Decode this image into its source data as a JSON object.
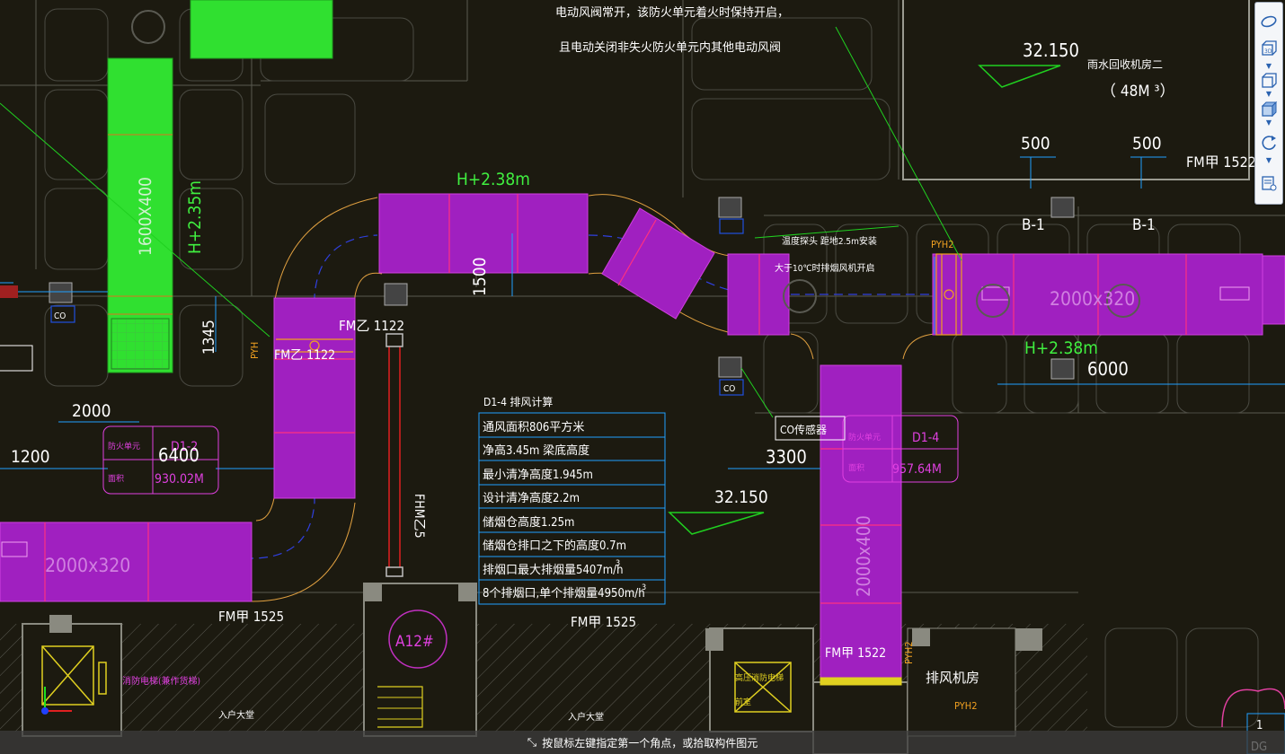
{
  "notes": {
    "line1": "电动风阀常开，该防火单元着火时保持开启，",
    "line2": "且电动关闭非失火防火单元内其他电动风阀"
  },
  "drawing_labels": {
    "elev_top": "32.150",
    "room_name": "雨水回收机房二",
    "room_area": "（ 48M ³）",
    "dim_500_a": "500",
    "dim_500_b": "500",
    "fm_1522_top": "FM甲 1522",
    "b1_a": "B-1",
    "b1_b": "B-1",
    "h238_top": "H+2.38m",
    "h235": "H+2.35m",
    "duct_160x400": "1600X400",
    "dim_1500": "1500",
    "dim_1345": "1345",
    "fm_1122_a": "FM乙 1122",
    "fm_1122_b": "FM乙 1122",
    "pyh_left": "PYH",
    "pyh2_top": "PYH2",
    "co_left": "CO",
    "co_mid": "CO",
    "dim_2000": "2000",
    "dim_1200": "1200",
    "d12_name": "D1-2",
    "d12_a": "防火单元",
    "d12_b": "面积",
    "d12_area": "930.02M",
    "duct_6400": "6400",
    "duct_2000x320_left": "2000x320",
    "duct_2000x320_right": "2000x320",
    "h238_right": "H+2.38m",
    "dim_6000": "6000",
    "dim_3300": "3300",
    "elev_mid": "32.150",
    "co_sensor": "CO传感器",
    "d14_name": "D1-4",
    "d14_a": "防火单元",
    "d14_b": "面积",
    "d14_area": "957.64M",
    "duct_2000x400": "2000x400",
    "fm_1525_left": "FM甲 1525",
    "fm_1525_mid": "FM甲 1525",
    "fm_1522_bottom": "FM甲 1522",
    "a12": "A12#",
    "fhm": "FHM乙5",
    "pyh_bottom": "PYH2",
    "pyh2_bottom_right": "PYH2",
    "exhaust_room": "排风机房",
    "entrance_a": "入户大堂",
    "entrance_b": "入户大堂",
    "yellow_note_a": "高压消防电梯",
    "yellow_note_b": "前室",
    "magenta_note": "消防电梯(兼作货梯)",
    "exhaust_note_a": "温度探头 距地2.5m安装",
    "exhaust_note_b": "大于10℃时排烟风机开启",
    "bottom_right_a": "1",
    "bottom_right_b": "DG"
  },
  "table": {
    "title": "D1-4 排风计算",
    "rows": [
      "通风面积806平方米",
      "净高3.45m 梁底高度",
      "最小清净高度1.945m",
      "设计清净高度2.2m",
      "储烟仓高度1.25m",
      "储烟仓排口之下的高度0.7m",
      "排烟口最大排烟量5407m/h",
      "8个排烟口,单个排烟量4950m/h"
    ],
    "sup_a": "3",
    "sup_b": "3"
  },
  "toolbar": {
    "items": [
      "orbit-icon",
      "view-3d-icon",
      "cube-outline-icon",
      "cube-solid-icon",
      "rotate-icon",
      "properties-icon"
    ],
    "label_3d": "3D"
  },
  "status": {
    "icon": "cursor-cross-icon",
    "text": "按鼠标左键指定第一个角点，或拾取构件图元"
  },
  "colors": {
    "background": "#1c1a10",
    "duct_magenta": "#a020c0",
    "duct_green": "#30e030",
    "dim_cyan": "#20a0ff",
    "wall_gray": "#8a8a80",
    "status_bg": "#3c3c3c"
  }
}
